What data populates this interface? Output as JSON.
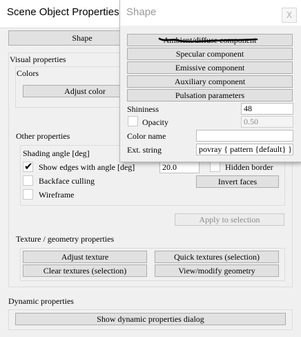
{
  "main_window": {
    "title": "Scene Object Properties",
    "tab_shape": "Shape",
    "visual_properties": "Visual properties",
    "colors": "Colors",
    "adjust_color": "Adjust color",
    "other_properties": "Other properties",
    "shading_angle": "Shading angle [deg]",
    "show_edges_with_angle": "Show edges with angle [deg]",
    "show_edges_checked": true,
    "edge_angle_value": "20.0",
    "hidden_border": "Hidden border",
    "backface_culling": "Backface culling",
    "invert_faces": "Invert faces",
    "wireframe": "Wireframe",
    "apply_to_selection": "Apply to selection",
    "texture_geometry": "Texture / geometry properties",
    "adjust_texture": "Adjust texture",
    "quick_textures": "Quick textures (selection)",
    "clear_textures": "Clear textures (selection)",
    "view_modify_geometry": "View/modify geometry",
    "dynamic_properties": "Dynamic properties",
    "show_dynamic_dialog": "Show dynamic properties dialog"
  },
  "shape_window": {
    "title": "Shape",
    "close_glyph": "X",
    "buttons": [
      "Ambient/diffuse component",
      "Specular component",
      "Emissive component",
      "Auxiliary component",
      "Pulsation parameters"
    ],
    "shininess_label": "Shininess",
    "shininess_value": "48",
    "opacity_label": "Opacity",
    "opacity_value": "0.50",
    "opacity_checked": false,
    "color_name_label": "Color name",
    "color_name_value": "",
    "ext_string_label": "Ext. string",
    "ext_string_value": "povray { pattern {default} }"
  }
}
